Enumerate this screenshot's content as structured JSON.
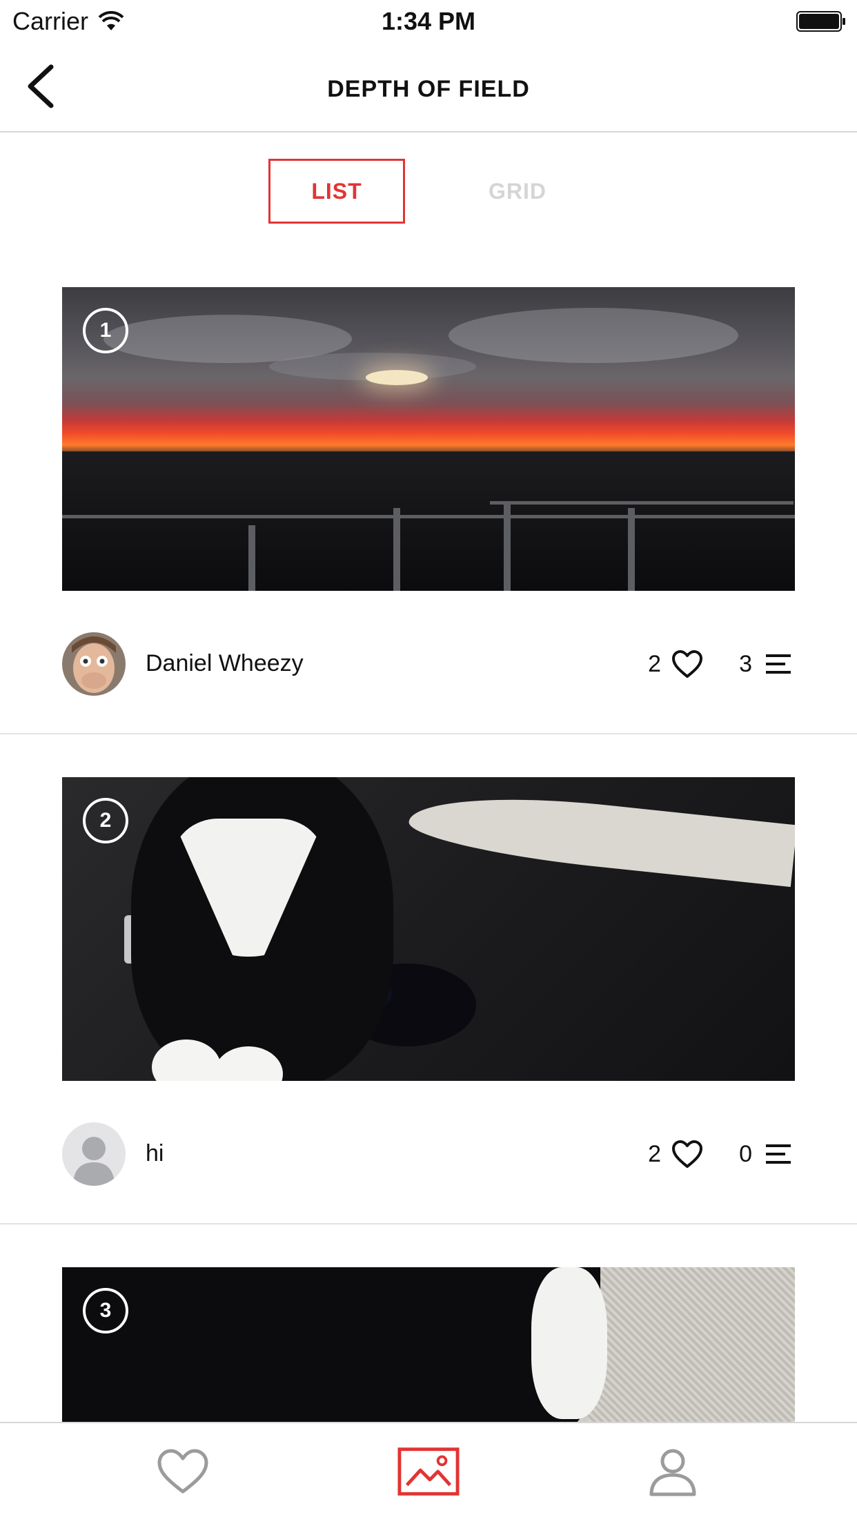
{
  "status_bar": {
    "carrier": "Carrier",
    "time": "1:34 PM"
  },
  "nav": {
    "title": "DEPTH OF FIELD"
  },
  "view_toggle": {
    "list_label": "LIST",
    "grid_label": "GRID",
    "selected": "LIST"
  },
  "posts": [
    {
      "rank": "1",
      "username": "Daniel Wheezy",
      "likes": "2",
      "comments": "3",
      "image": "sunset-balcony"
    },
    {
      "rank": "2",
      "username": "hi",
      "likes": "2",
      "comments": "0",
      "image": "cat-on-desk"
    },
    {
      "rank": "3",
      "image": "cat-on-carpet"
    }
  ],
  "tab_bar": {
    "items": [
      "likes-heart-icon",
      "gallery-image-icon",
      "profile-person-icon"
    ],
    "selected": "gallery-image-icon"
  },
  "colors": {
    "accent": "#e23434",
    "inactive": "#d5d5d5",
    "divider": "#e3e3e3",
    "tab_icon": "#9b9b9b"
  }
}
